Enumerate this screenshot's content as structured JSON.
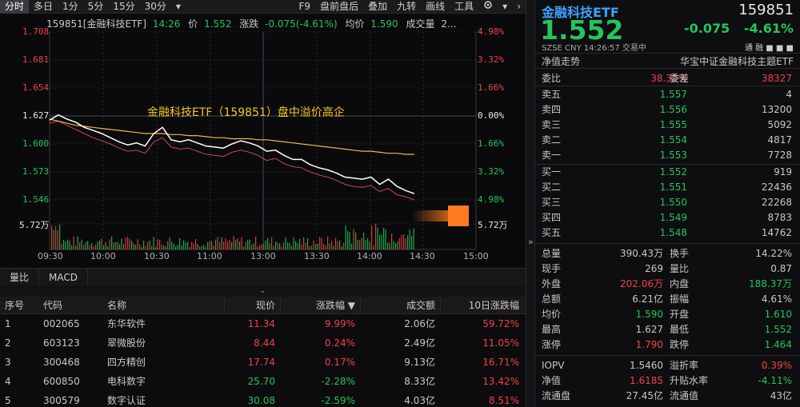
{
  "toolbar": {
    "tabs": [
      "分时",
      "多日",
      "1分",
      "5分",
      "15分",
      "30分"
    ],
    "dropdown": "▾",
    "right_items": [
      "F9",
      "盘前盘后",
      "叠加",
      "九转",
      "画线",
      "工具"
    ]
  },
  "info": {
    "code_name": "159851[金融科技ETF]",
    "time": "14:26",
    "price_label": "价",
    "price": "1.552",
    "change_label": "涨跌",
    "change": "-0.075(-4.61%)",
    "avg_label": "均价",
    "avg": "1.590",
    "volume_label": "成交量",
    "volume": "2..."
  },
  "chart": {
    "y_left": [
      "1.708",
      "1.681",
      "1.654",
      "1.627",
      "1.600",
      "1.573",
      "1.546"
    ],
    "y_right": [
      "4.98%",
      "3.32%",
      "1.66%",
      "0.00%",
      "1.66%",
      "3.32%",
      "4.98%"
    ],
    "vol_left": "5.72万",
    "vol_right": "5.72万",
    "x_ticks": [
      "09:30",
      "10:00",
      "10:30",
      "11:00",
      "13:00",
      "13:30",
      "14:00",
      "14:30",
      "15:00"
    ],
    "annotation": "金融科技ETF（159851）盘中溢价高企"
  },
  "chart_data": {
    "type": "line",
    "title": "金融科技ETF（159851）盘中溢价高企",
    "ylim": [
      1.546,
      1.708
    ],
    "series": [
      {
        "name": "价",
        "values": [
          1.623,
          1.628,
          1.624,
          1.621,
          1.616,
          1.613,
          1.61,
          1.606,
          1.602,
          1.599,
          1.601,
          1.598,
          1.61,
          1.616,
          1.604,
          1.602,
          1.604,
          1.601,
          1.598,
          1.597,
          1.596,
          1.6,
          1.603,
          1.601,
          1.598,
          1.593,
          1.594,
          1.589,
          1.585,
          1.585,
          1.58,
          1.577,
          1.575,
          1.572,
          1.568,
          1.567,
          1.566,
          1.568,
          1.561,
          1.566,
          1.559,
          1.555,
          1.552
        ]
      },
      {
        "name": "均价",
        "values": [
          1.624,
          1.622,
          1.62,
          1.618,
          1.617,
          1.616,
          1.615,
          1.614,
          1.613,
          1.612,
          1.611,
          1.61,
          1.61,
          1.61,
          1.609,
          1.609,
          1.608,
          1.608,
          1.607,
          1.606,
          1.606,
          1.605,
          1.605,
          1.605,
          1.604,
          1.604,
          1.603,
          1.602,
          1.601,
          1.6,
          1.599,
          1.598,
          1.597,
          1.596,
          1.595,
          1.594,
          1.593,
          1.593,
          1.592,
          1.591,
          1.591,
          1.59,
          1.59
        ]
      },
      {
        "name": "IOPV",
        "values": [
          1.62,
          1.622,
          1.618,
          1.614,
          1.61,
          1.606,
          1.603,
          1.6,
          1.596,
          1.593,
          1.594,
          1.591,
          1.602,
          1.606,
          1.597,
          1.595,
          1.596,
          1.593,
          1.59,
          1.589,
          1.588,
          1.592,
          1.594,
          1.592,
          1.589,
          1.584,
          1.586,
          1.581,
          1.578,
          1.577,
          1.573,
          1.57,
          1.568,
          1.565,
          1.561,
          1.559,
          1.558,
          1.56,
          1.554,
          1.557,
          1.551,
          1.549,
          1.546
        ]
      }
    ]
  },
  "lower_tabs": [
    "量比",
    "MACD"
  ],
  "collapse": "⌄",
  "table": {
    "headers": [
      "序号",
      "代码",
      "名称",
      "现价",
      "涨跌幅 ▼",
      "成交额",
      "10日涨跌幅"
    ],
    "rows": [
      [
        "1",
        "002065",
        "东华软件",
        "11.34",
        "9.99%",
        "2.06亿",
        "59.72%"
      ],
      [
        "2",
        "603123",
        "翠微股份",
        "8.44",
        "0.24%",
        "2.49亿",
        "11.05%"
      ],
      [
        "3",
        "300468",
        "四方精创",
        "17.74",
        "0.17%",
        "9.13亿",
        "16.71%"
      ],
      [
        "4",
        "600850",
        "电科数字",
        "25.70",
        "-2.28%",
        "8.33亿",
        "13.42%"
      ],
      [
        "5",
        "300579",
        "数字认证",
        "30.08",
        "-2.59%",
        "4.03亿",
        "8.51%"
      ]
    ]
  },
  "quote": {
    "title": "金融科技ETF",
    "code": "159851",
    "price": "1.552",
    "change": "-0.075",
    "change_pct": "-4.61%",
    "meta": "SZSE  CNY  14:26:57  交易中",
    "icons": "通  融  ■  ■  ■",
    "nav_left": "净值走势",
    "nav_right": "华宝中证金融科技主题ETF",
    "weibi_label": "委比",
    "weibi": "38.32%",
    "weicha_label": "委差",
    "weicha": "38327",
    "asks": [
      {
        "n": "卖五",
        "p": "1.557",
        "v": "4"
      },
      {
        "n": "卖四",
        "p": "1.556",
        "v": "13200"
      },
      {
        "n": "卖三",
        "p": "1.555",
        "v": "5092"
      },
      {
        "n": "卖二",
        "p": "1.554",
        "v": "4817"
      },
      {
        "n": "卖一",
        "p": "1.553",
        "v": "7728"
      }
    ],
    "bids": [
      {
        "n": "买一",
        "p": "1.552",
        "v": "919"
      },
      {
        "n": "买二",
        "p": "1.551",
        "v": "22436"
      },
      {
        "n": "买三",
        "p": "1.550",
        "v": "22268"
      },
      {
        "n": "买四",
        "p": "1.549",
        "v": "8783"
      },
      {
        "n": "买五",
        "p": "1.548",
        "v": "14762"
      }
    ],
    "stats": [
      [
        "总量",
        "390.43万",
        "换手",
        "14.22%"
      ],
      [
        "现手",
        "269",
        "量比",
        "0.87"
      ],
      [
        "外盘",
        "202.06万",
        "内盘",
        "188.37万"
      ],
      [
        "总额",
        "6.21亿",
        "振幅",
        "4.61%"
      ],
      [
        "均价",
        "1.590",
        "开盘",
        "1.610"
      ],
      [
        "最高",
        "1.627",
        "最低",
        "1.552"
      ],
      [
        "涨停",
        "1.790",
        "跌停",
        "1.464"
      ]
    ],
    "stats2": [
      [
        "IOPV",
        "1.5460",
        "溢折率",
        "0.39%"
      ],
      [
        "净值",
        "1.6185",
        "升贴水率",
        "-4.11%"
      ],
      [
        "流通盘",
        "27.45亿",
        "流通值",
        "43亿"
      ]
    ],
    "colors": {
      "up": "#f0404a",
      "down": "#23c55e",
      "accent": "#3fa0ff",
      "avg": "#e8b84a"
    }
  }
}
